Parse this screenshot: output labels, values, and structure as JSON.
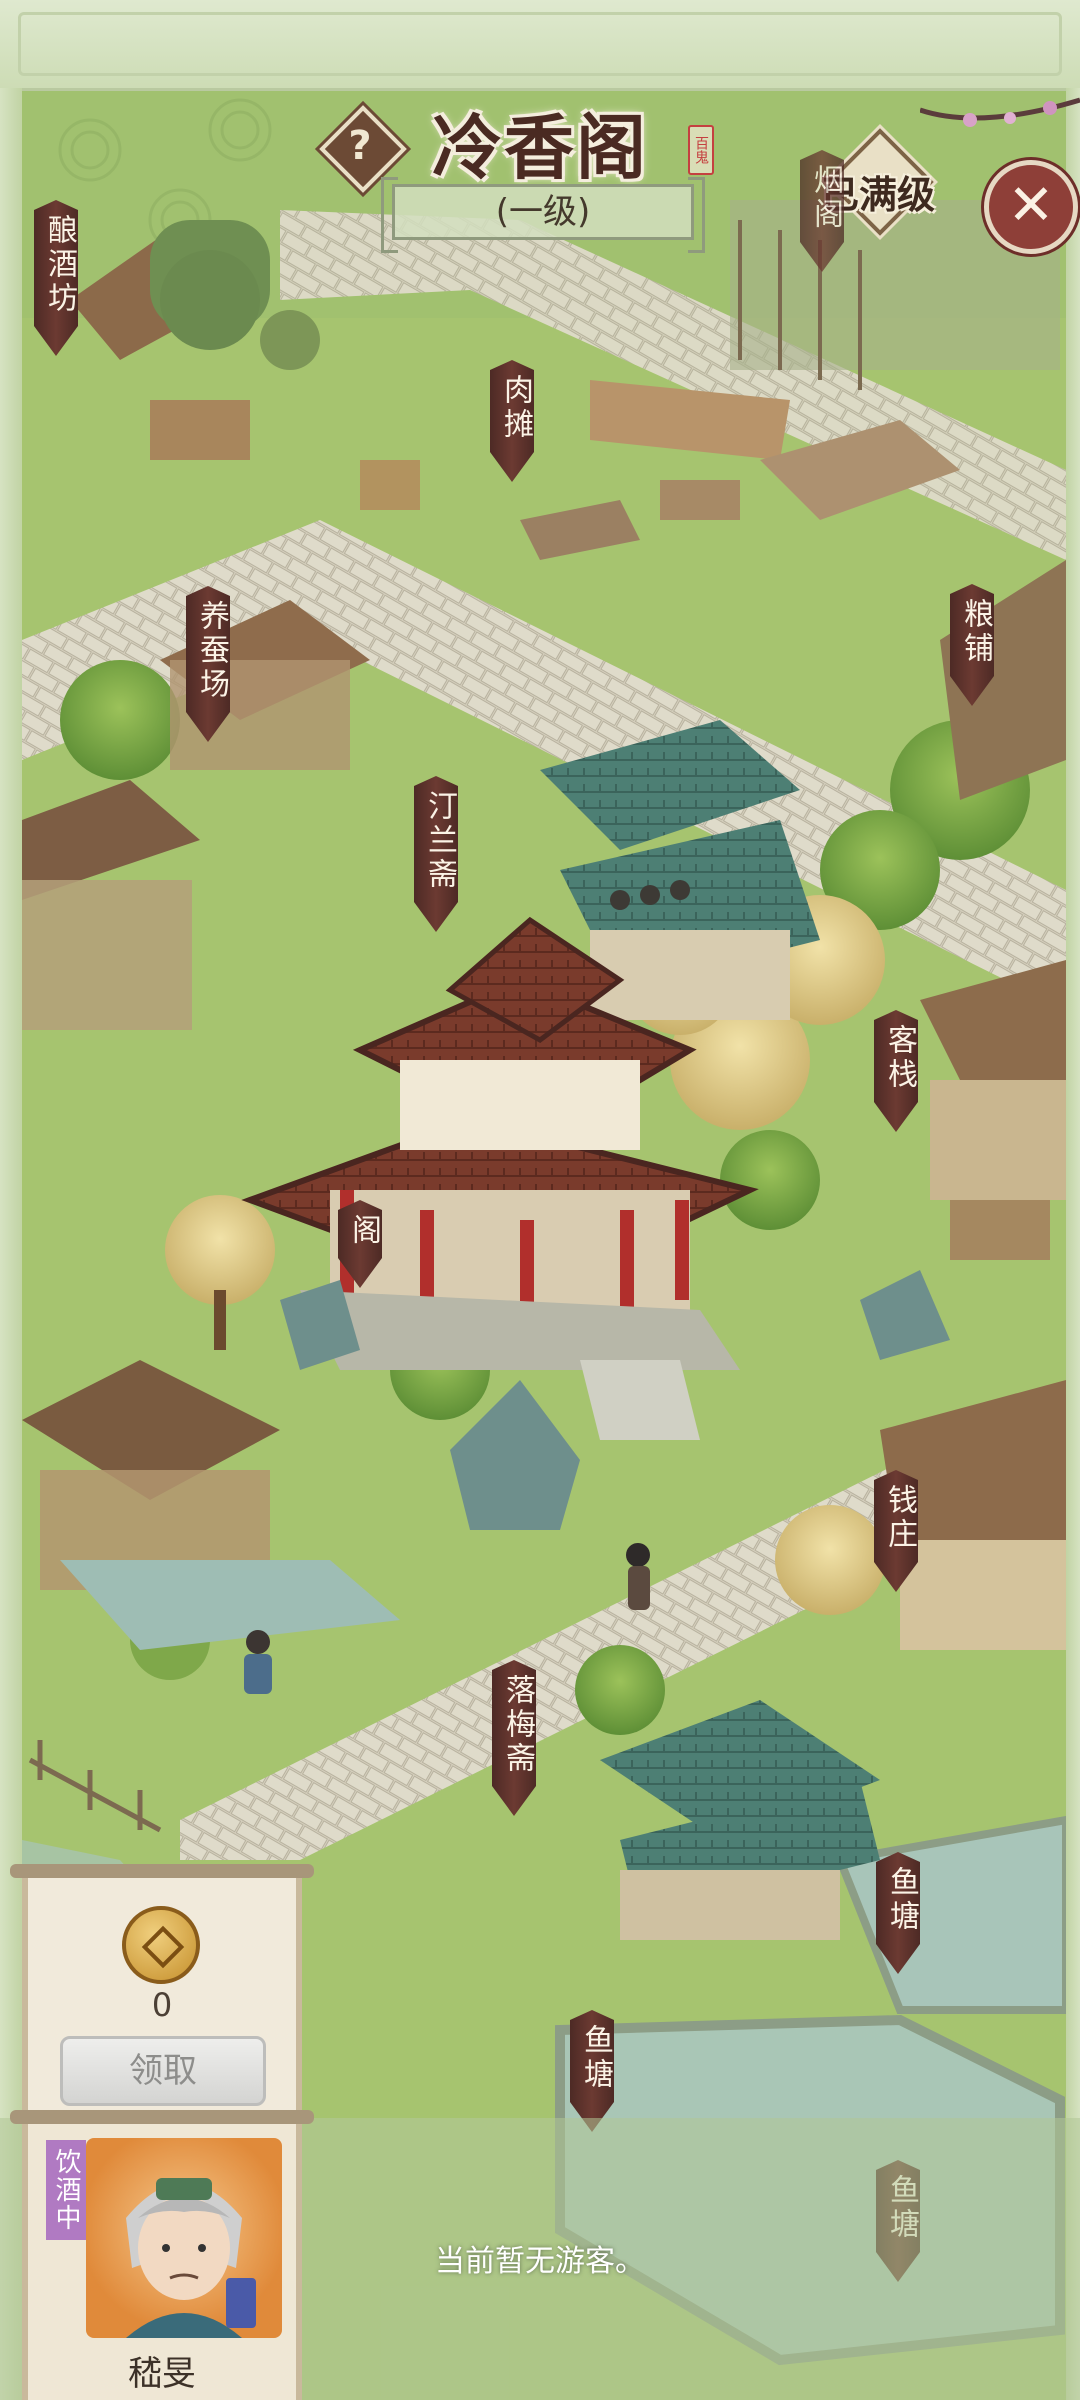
{
  "header": {
    "title": "冷香阁",
    "seal_text": "百鬼",
    "level": "(一级)",
    "max_level_badge": "已满级",
    "help_glyph": "?",
    "close_glyph": "✕"
  },
  "buildings": [
    {
      "key": "brewery",
      "name": "酿酒坊"
    },
    {
      "key": "top-pavilion",
      "name": "烟阁"
    },
    {
      "key": "meat-stall",
      "name": "肉摊"
    },
    {
      "key": "silkworm",
      "name": "养蚕场"
    },
    {
      "key": "grain-shop",
      "name": "粮铺"
    },
    {
      "key": "tinglan",
      "name": "汀兰斋"
    },
    {
      "key": "inn",
      "name": "客栈"
    },
    {
      "key": "main-pavilion",
      "name": "阁"
    },
    {
      "key": "bank",
      "name": "钱庄"
    },
    {
      "key": "luomei",
      "name": "落梅斋"
    },
    {
      "key": "fishpond-1",
      "name": "鱼塘"
    },
    {
      "key": "fishpond-2",
      "name": "鱼塘"
    },
    {
      "key": "fishpond-3",
      "name": "鱼塘"
    }
  ],
  "reward": {
    "coin_count": "0",
    "claim_label": "领取"
  },
  "guest_status": "当前暂无游客。",
  "character": {
    "status": "饮酒中",
    "name": "嵇旻"
  },
  "colors": {
    "grass": "#a7c46f",
    "path": "#cfc6b6",
    "label_bg": "#5a3029",
    "close_button": "#8e3f38"
  }
}
